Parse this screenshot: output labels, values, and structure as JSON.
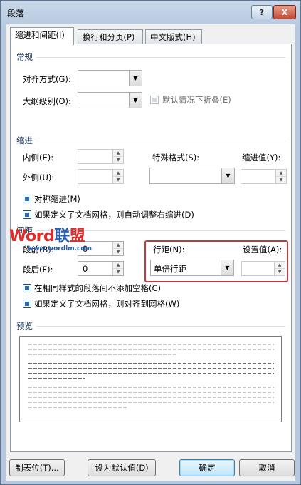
{
  "window": {
    "title": "段落",
    "help_label": "?",
    "close_label": "X"
  },
  "tabs": [
    {
      "label": "缩进和间距(I)",
      "active": true
    },
    {
      "label": "换行和分页(P)",
      "active": false
    },
    {
      "label": "中文版式(H)",
      "active": false
    }
  ],
  "general": {
    "section_title": "常规",
    "alignment_label": "对齐方式(G):",
    "alignment_value": "",
    "outline_label": "大纲级别(O):",
    "outline_value": "",
    "collapse_label": "默认情况下折叠(E)"
  },
  "indent": {
    "section_title": "缩进",
    "inner_label": "内侧(E):",
    "inner_value": "",
    "outer_label": "外侧(U):",
    "outer_value": "",
    "special_label": "特殊格式(S):",
    "special_value": "",
    "indent_by_label": "缩进值(Y):",
    "indent_by_value": "",
    "mirror_label": "对称缩进(M)",
    "mirror_checked": true,
    "auto_adjust_label": "如果定义了文档网格，则自动调整右缩进(D)",
    "auto_adjust_checked": true
  },
  "spacing": {
    "section_title": "间距",
    "before_label": "段前(B):",
    "before_value": "0",
    "after_label": "段后(F):",
    "after_value": "0",
    "line_spacing_label": "行距(N):",
    "line_spacing_value": "单倍行距",
    "at_label": "设置值(A):",
    "at_value": "",
    "no_space_label": "在相同样式的段落间不添加空格(C)",
    "no_space_checked": true,
    "snap_grid_label": "如果定义了文档网格，则对齐到网格(W)",
    "snap_grid_checked": true
  },
  "preview": {
    "section_title": "预览"
  },
  "watermark": {
    "word": "Word",
    "lian": "联",
    "meng": "盟",
    "url": "www.wordlm.com"
  },
  "buttons": {
    "tabs": "制表位(T)...",
    "set_default": "设为默认值(D)",
    "ok": "确定",
    "cancel": "取消"
  }
}
